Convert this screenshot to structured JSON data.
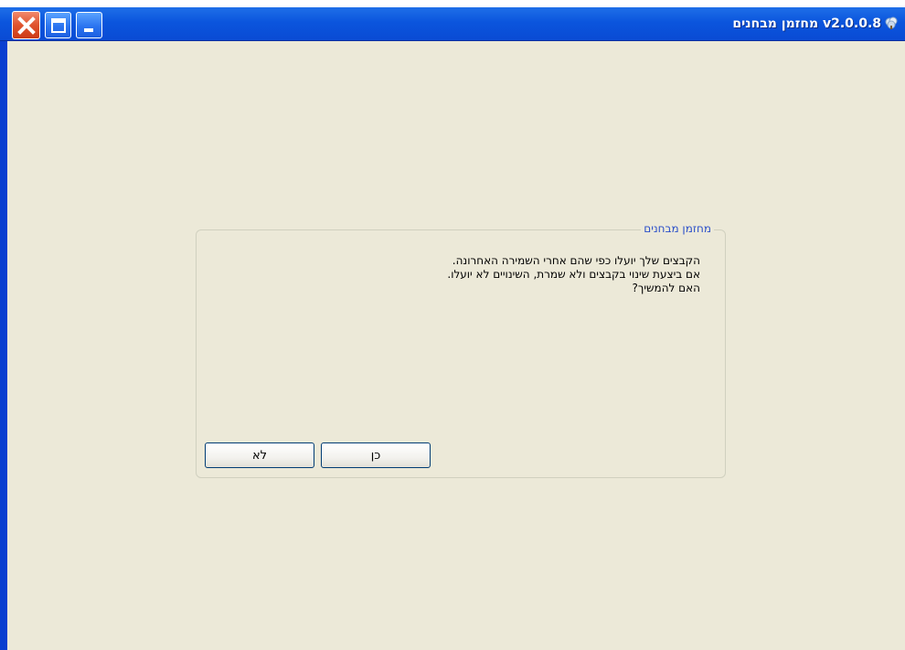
{
  "window": {
    "title": "v2.0.0.8 מחזמן מבחנים",
    "controls": {
      "close_icon": "close-icon",
      "maximize_icon": "maximize-icon",
      "minimize_icon": "minimize-icon"
    },
    "app_icon": "app-icon"
  },
  "dialog": {
    "group_title": "מחזמן מבחנים",
    "message_lines": [
      "הקבצים שלך יועלו כפי שהם אחרי השמירה האחרונה.",
      "אם ביצעת שינוי בקבצים ולא שמרת, השינויים לא יועלו.",
      "האם להמשיך?"
    ],
    "yes_label": "כן",
    "no_label": "לא"
  },
  "colors": {
    "titlebar": "#0a55dd",
    "client_background": "#ece9d8",
    "group_title": "#2b4fc9",
    "close_button": "#e0532d"
  }
}
